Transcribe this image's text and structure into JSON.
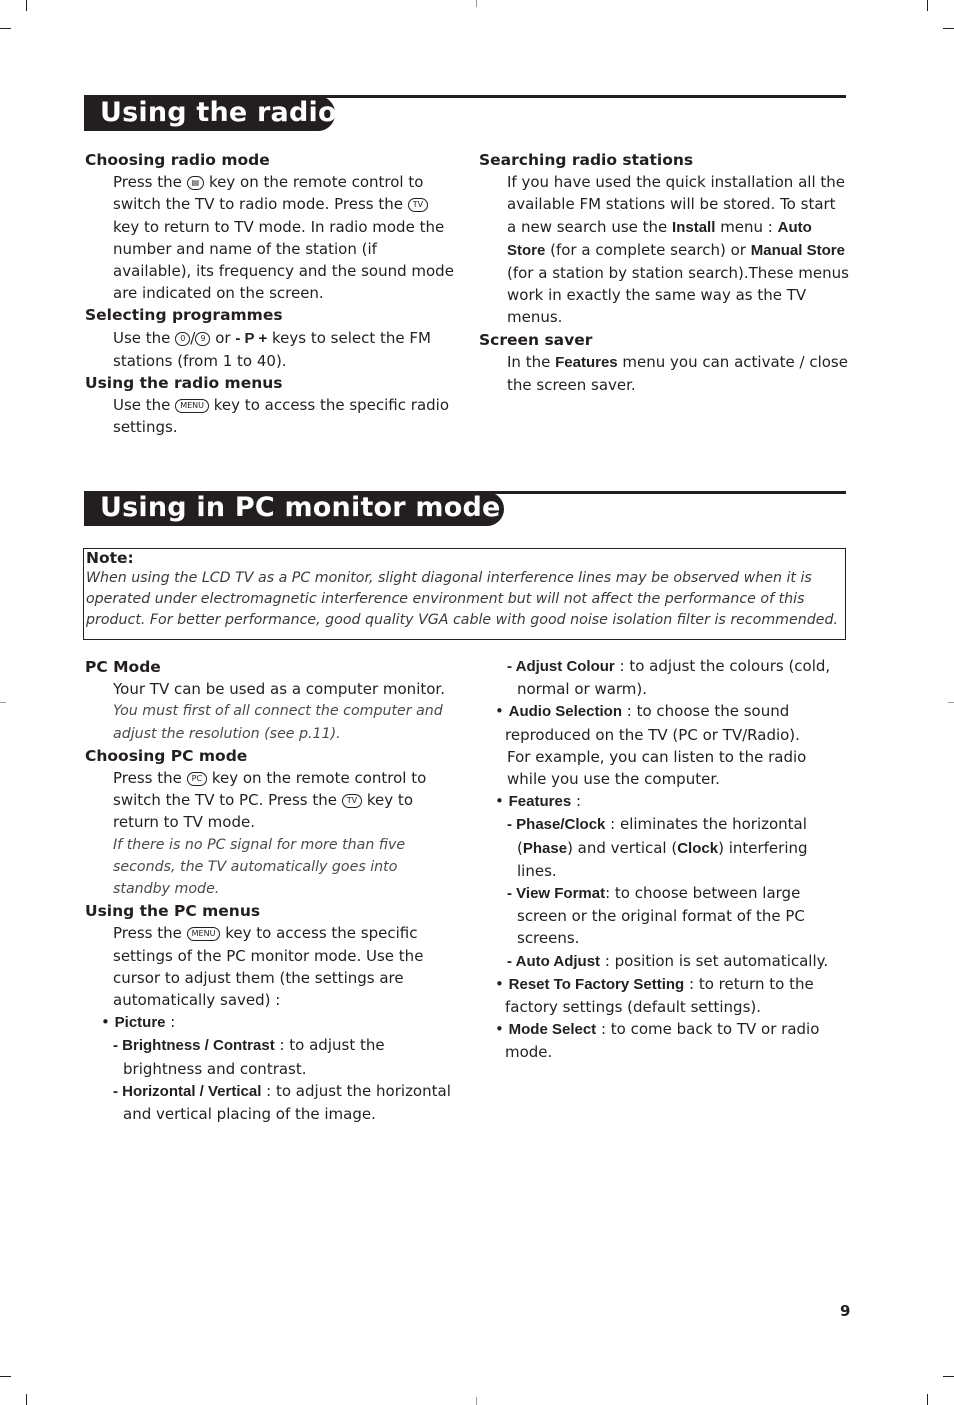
{
  "radio_section": {
    "title": "Using the radio",
    "left": [
      {
        "heading": "Choosing radio mode",
        "text_before_key1": "Press the",
        "key1_icon": "radio-key-icon",
        "text_after_key1": "key on the remote control to switch the TV to radio mode.  Press the",
        "key2": "TV",
        "text_after_key2": "key to return to TV mode.  In radio mode the number and name of the station (if available), its frequency and the sound mode are indicated on the screen."
      },
      {
        "heading": "Selecting programmes",
        "text_before": "Use the",
        "key_a": "0",
        "key_sep": "/",
        "key_b": "9",
        "text_or": "or",
        "bold_keys": "- P +",
        "text_after": "keys to select the FM stations (from 1 to 40)."
      },
      {
        "heading": "Using the radio menus",
        "text_before": "Use the",
        "key": "MENU",
        "text_after": "key to access the specific radio settings."
      }
    ],
    "right": [
      {
        "heading": "Searching radio stations",
        "t1": "If you have used the quick installation all the available FM stations will be stored.  To start a new search use the",
        "b1": "Install",
        "t2": "menu :",
        "b2": "Auto Store",
        "t3": "(for a complete search) or",
        "b3": "Manual Store",
        "t4": "(for a station by station search).These menus work in exactly the same way as the TV menus."
      },
      {
        "heading": "Screen saver",
        "t1": "In the",
        "b1": "Features",
        "t2": "menu you can activate / close the screen saver."
      }
    ]
  },
  "pc_section": {
    "title": "Using in PC monitor mode",
    "note": {
      "title": "Note:",
      "text": "When using the LCD TV as a PC monitor, slight diagonal interference lines may be observed when it is operated under electromagnetic interference environment but will not affect the performance of this product. For better performance, good quality VGA cable with good noise isolation filter is recommended."
    },
    "pc_mode": {
      "heading": "PC Mode",
      "text": "Your TV can be used as a computer monitor.",
      "italic": "You must first of all connect the computer and adjust the resolution (see p.11)."
    },
    "choosing_pc_mode": {
      "heading": "Choosing PC mode",
      "t1": "Press the",
      "key1": "PC",
      "t2": "key on the remote control to switch the TV to PC. Press the",
      "key2": "TV",
      "t3": "key to return to TV mode.",
      "italic": "If there is no PC signal for more than five seconds, the TV automatically goes into standby mode."
    },
    "pc_menus": {
      "heading": "Using the PC menus",
      "t1": "Press the",
      "key": "MENU",
      "t2": "key to access the specific settings of the PC monitor mode.  Use the cursor to adjust them (the settings are automatically saved) :",
      "picture": {
        "label": "Picture",
        "suffix": " :"
      },
      "brightness": {
        "label": "Brightness / Contrast",
        "text": " : to adjust the brightness and contrast."
      },
      "horizontal": {
        "label": "Horizontal / Vertical",
        "text": " : to adjust the horizontal and vertical placing of the image."
      },
      "adjust_colour": {
        "label": "Adjust Colour",
        "text": " : to adjust the colours (cold, normal or warm)."
      },
      "audio_selection": {
        "label": "Audio Selection",
        "text": " : to choose the sound reproduced on the TV (PC or TV/Radio).",
        "extra": "For example, you can listen to the radio while you use the computer."
      },
      "features": {
        "label": "Features",
        "suffix": " :"
      },
      "phase_clock": {
        "label": "Phase/Clock",
        "t1": " : eliminates the horizontal (",
        "b1": "Phase",
        "t2": ") and vertical (",
        "b2": "Clock",
        "t3": ") interfering lines."
      },
      "view_format": {
        "label": "View Format",
        "text": ": to choose between large screen or the original format of the PC screens."
      },
      "auto_adjust": {
        "label": "Auto Adjust",
        "text": " : position is set automatically."
      },
      "reset": {
        "label": "Reset To Factory Setting",
        "text": " : to return to the factory settings (default settings)."
      },
      "mode_select": {
        "label": "Mode Select",
        "text": " : to come back to TV or radio mode."
      }
    }
  },
  "symbols": {
    "bullet": "•",
    "dash": "- "
  },
  "page_number": "9"
}
